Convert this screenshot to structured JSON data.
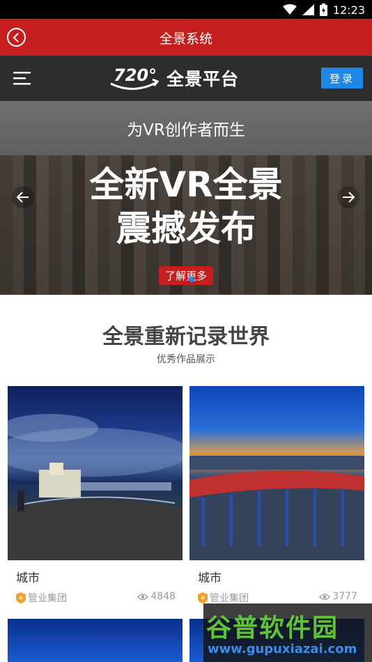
{
  "status_bar": {
    "time": "12:23"
  },
  "title_bar": {
    "title": "全景系统"
  },
  "nav_bar": {
    "logo_badge": "720°",
    "logo_text": "全景平台",
    "login_label": "登录"
  },
  "banner": {
    "subtitle": "为VR创作者而生",
    "headline_line1": "全新VR全景",
    "headline_line2": "震撼发布",
    "cta_label": "了解更多"
  },
  "section": {
    "title": "全景重新记录世界",
    "subtitle": "优秀作品展示"
  },
  "works": [
    {
      "name": "城市",
      "author": "管业集团",
      "views": "4848"
    },
    {
      "name": "城市",
      "author": "管业集团",
      "views": "3777"
    }
  ],
  "watermark": {
    "line1": "谷普软件园",
    "line2": "www.gupuxiazai.com"
  },
  "colors": {
    "primary_red": "#c41e1e",
    "login_blue": "#1f87e8",
    "nav_dark": "#2d2d2d"
  },
  "icons": {
    "back": "back-circle-icon",
    "menu": "hamburger-icon",
    "wifi": "wifi-icon",
    "signal": "signal-icon",
    "battery": "battery-icon",
    "eye": "eye-icon",
    "badge": "author-badge-icon"
  }
}
